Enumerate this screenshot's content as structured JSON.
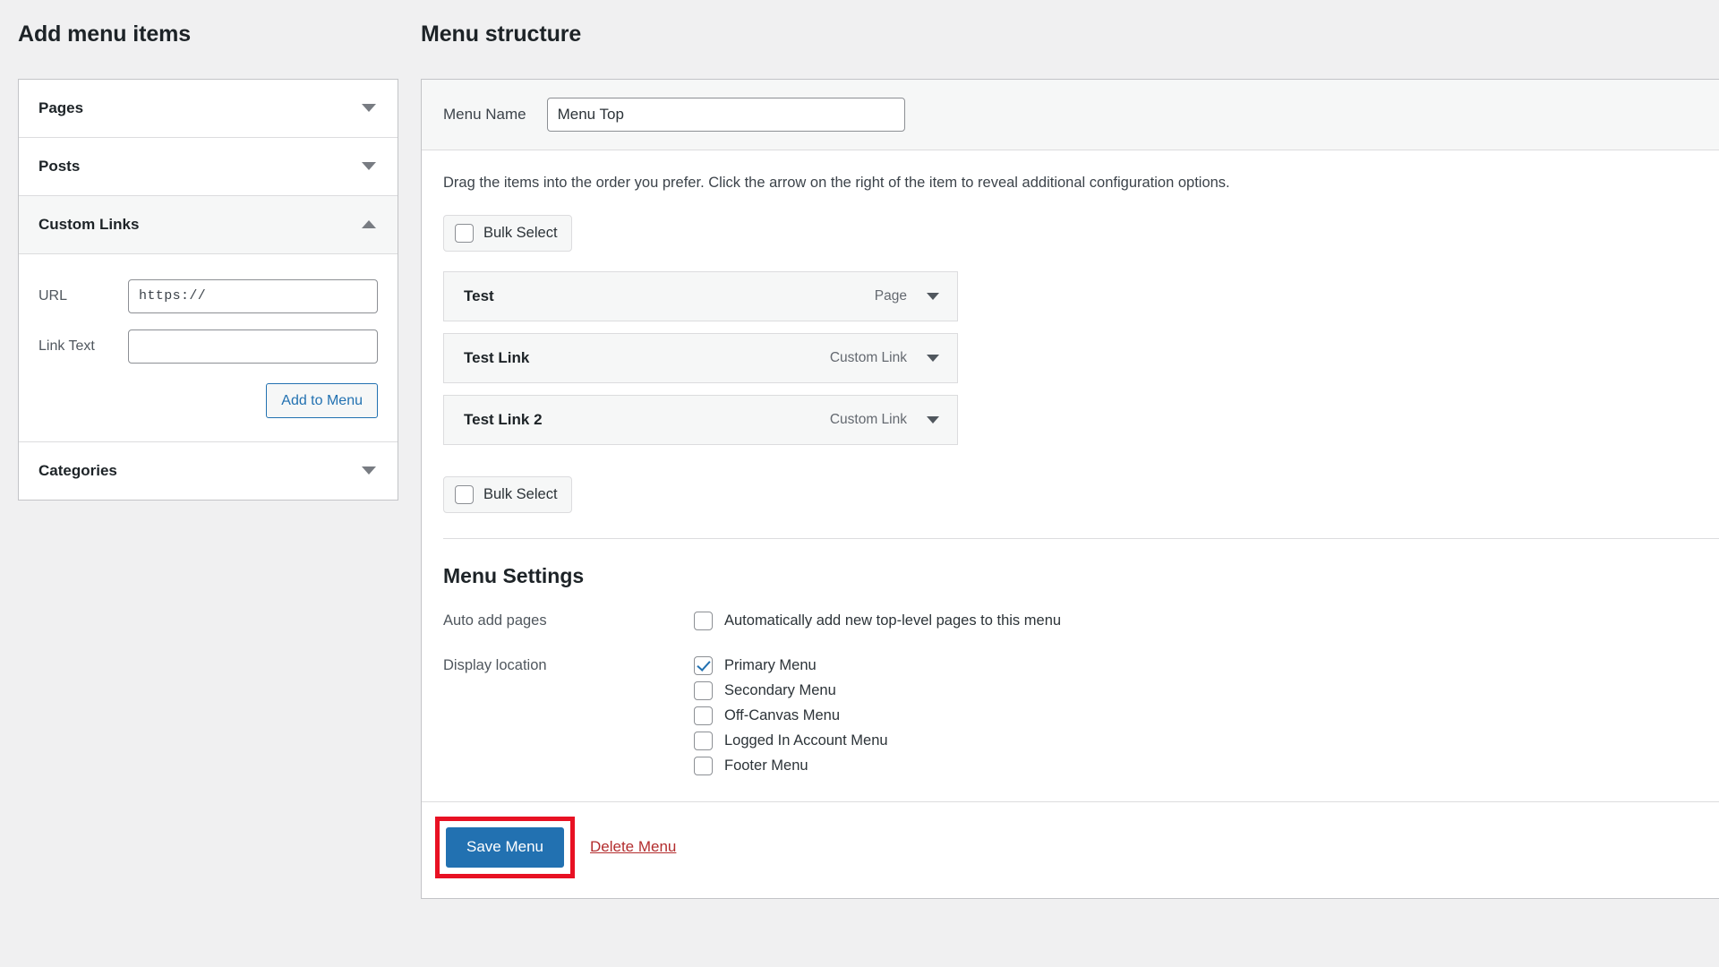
{
  "left": {
    "title": "Add menu items",
    "accordion": [
      {
        "label": "Pages",
        "expanded": false,
        "icon": "chevron-down-icon"
      },
      {
        "label": "Posts",
        "expanded": false,
        "icon": "chevron-down-icon"
      },
      {
        "label": "Custom Links",
        "expanded": true,
        "icon": "chevron-up-icon"
      },
      {
        "label": "Categories",
        "expanded": false,
        "icon": "chevron-down-icon"
      }
    ],
    "custom_links": {
      "url_label": "URL",
      "url_value": "https://",
      "link_text_label": "Link Text",
      "link_text_value": "",
      "add_button": "Add to Menu"
    }
  },
  "right": {
    "title": "Menu structure",
    "menu_name_label": "Menu Name",
    "menu_name_value": "Menu Top",
    "hint": "Drag the items into the order you prefer. Click the arrow on the right of the item to reveal additional configuration options.",
    "bulk_select_label": "Bulk Select",
    "bulk_select_checked": false,
    "menu_items": [
      {
        "title": "Test",
        "type": "Page",
        "icon": "chevron-down-icon"
      },
      {
        "title": "Test Link",
        "type": "Custom Link",
        "icon": "chevron-down-icon"
      },
      {
        "title": "Test Link 2",
        "type": "Custom Link",
        "icon": "chevron-down-icon"
      }
    ],
    "settings": {
      "title": "Menu Settings",
      "auto_add_label": "Auto add pages",
      "auto_add_option": "Automatically add new top-level pages to this menu",
      "auto_add_checked": false,
      "display_location_label": "Display location",
      "locations": [
        {
          "label": "Primary Menu",
          "checked": true
        },
        {
          "label": "Secondary Menu",
          "checked": false
        },
        {
          "label": "Off-Canvas Menu",
          "checked": false
        },
        {
          "label": "Logged In Account Menu",
          "checked": false
        },
        {
          "label": "Footer Menu",
          "checked": false
        }
      ]
    },
    "save_button": "Save Menu",
    "delete_link": "Delete Menu"
  },
  "colors": {
    "accent": "#2271b1",
    "highlight": "#e81123",
    "danger": "#b32d2e",
    "panel_bg": "#f6f7f7",
    "page_bg": "#f0f0f1"
  }
}
